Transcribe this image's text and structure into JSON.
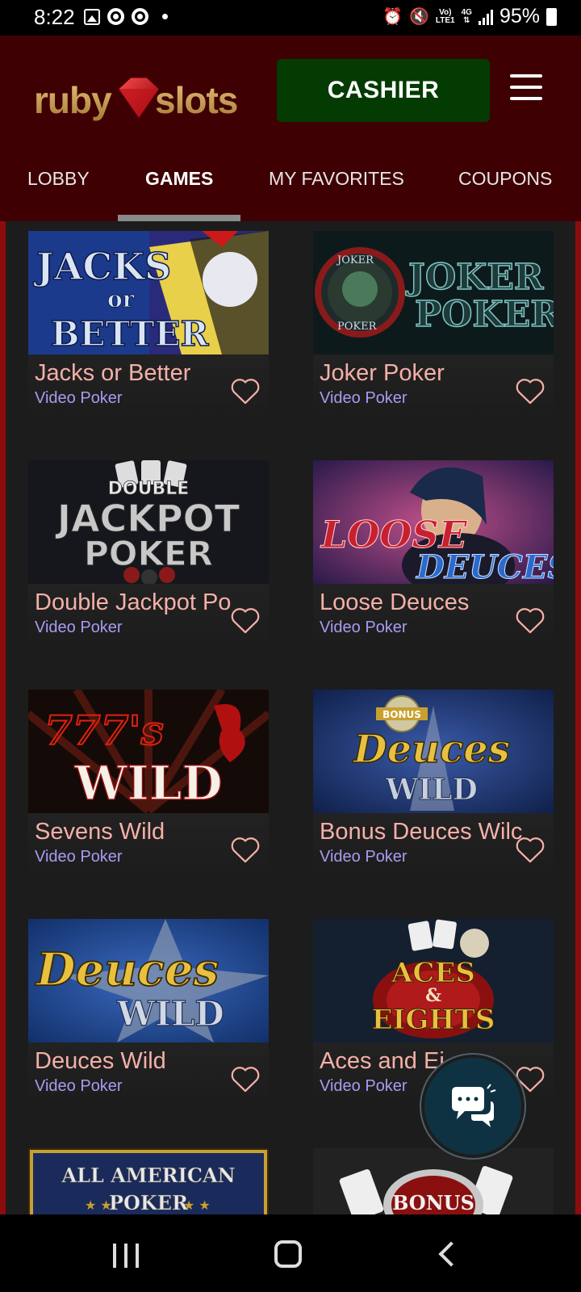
{
  "status_bar": {
    "time": "8:22",
    "network_top": "Vo)",
    "network_bottom": "LTE1",
    "lte_label": "4G",
    "battery": "95%",
    "icons": [
      "image-icon",
      "chrome-icon",
      "chrome-icon",
      "dot-icon",
      "alarm-icon",
      "mute-icon",
      "signal-icon",
      "battery-icon"
    ]
  },
  "header": {
    "logo_text": "rubyslots",
    "cashier_label": "CASHIER",
    "brand_colors": {
      "header_bg": "#3f0004",
      "cashier_bg": "#043b03",
      "accent_red": "#8c0b0f",
      "logo_gold": "#c8a25a"
    }
  },
  "nav": {
    "tabs": [
      {
        "label": "LOBBY",
        "active": false
      },
      {
        "label": "GAMES",
        "active": true
      },
      {
        "label": "MY FAVORITES",
        "active": false
      },
      {
        "label": "COUPONS",
        "active": false
      }
    ]
  },
  "games": [
    {
      "title": "Jacks or Better",
      "category": "Video Poker",
      "art_text": [
        "JACKS",
        "or",
        "BETTER"
      ]
    },
    {
      "title": "Joker Poker",
      "category": "Video Poker",
      "art_text": [
        "JOKER",
        "POKER",
        "JOKER POKER"
      ]
    },
    {
      "title": "Double Jackpot Po",
      "category": "Video Poker",
      "art_text": [
        "DOUBLE",
        "JACKPOT",
        "POKER"
      ]
    },
    {
      "title": "Loose Deuces",
      "category": "Video Poker",
      "art_text": [
        "LOOSE",
        "DEUCES"
      ]
    },
    {
      "title": "Sevens Wild",
      "category": "Video Poker",
      "art_text": [
        "777's",
        "WILD"
      ]
    },
    {
      "title": "Bonus Deuces Wilc",
      "category": "Video Poker",
      "art_text": [
        "BONUS",
        "Deuces",
        "WILD"
      ]
    },
    {
      "title": "Deuces Wild",
      "category": "Video Poker",
      "art_text": [
        "Deuces",
        "WILD"
      ]
    },
    {
      "title": "Aces and Ei",
      "category": "Video Poker",
      "art_text": [
        "ACES",
        "&",
        "EIGHTS"
      ]
    },
    {
      "title": "",
      "category": "",
      "art_text": [
        "ALL AMERICAN",
        "POKER"
      ]
    },
    {
      "title": "",
      "category": "",
      "art_text": [
        "BONUS"
      ]
    }
  ]
}
